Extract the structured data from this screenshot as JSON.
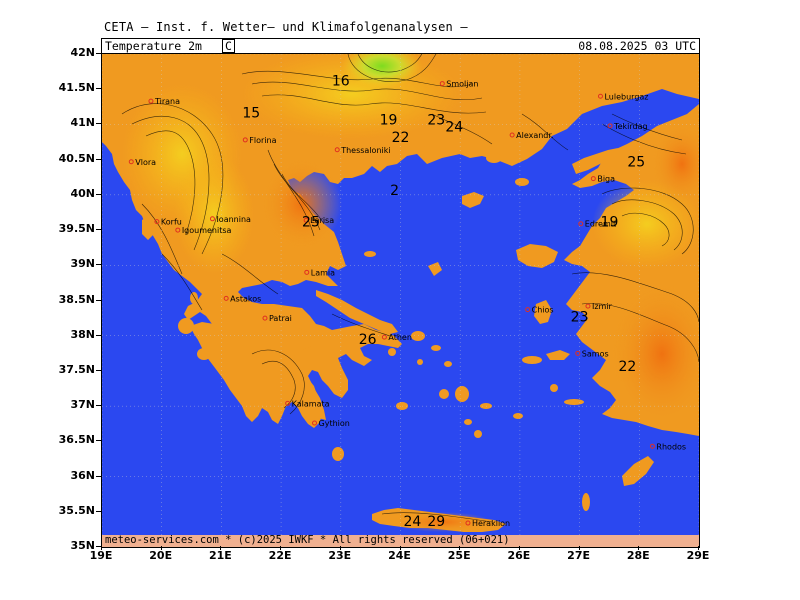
{
  "header": {
    "title": "CETA – Inst. f. Wetter– und Klimafolgenanalysen –"
  },
  "map": {
    "parameter": "Temperature 2m",
    "unit": "C",
    "valid_time": "08.08.2025 03 UTC",
    "footer": "meteo-services.com * (c)2025 IWKF * All rights reserved (06+021)",
    "lon_labels": [
      "19E",
      "20E",
      "21E",
      "22E",
      "23E",
      "24E",
      "25E",
      "26E",
      "27E",
      "28E",
      "29E"
    ],
    "lat_labels": [
      "42N",
      "41.5N",
      "41N",
      "40.5N",
      "40N",
      "39.5N",
      "39N",
      "38.5N",
      "38N",
      "37.5N",
      "37N",
      "36.5N",
      "36N",
      "35.5N",
      "35N"
    ],
    "colors": {
      "sea": "#2b48f0",
      "land_warm": "#f09a20",
      "land_hot": "#f07a10",
      "land_mild": "#f8b818",
      "land_cool": "#f4d020",
      "land_cold": "#c8e030",
      "land_coldest": "#78e020",
      "contour": "#000000",
      "city_marker": "#e03020"
    },
    "cities": [
      {
        "name": "Tirana",
        "lon": 19.82,
        "lat": 41.33
      },
      {
        "name": "Vlora",
        "lon": 19.49,
        "lat": 40.47
      },
      {
        "name": "Florina",
        "lon": 21.4,
        "lat": 40.78
      },
      {
        "name": "Thessaloniki",
        "lon": 22.94,
        "lat": 40.64
      },
      {
        "name": "Smoljan",
        "lon": 24.7,
        "lat": 41.58
      },
      {
        "name": "Alexandr.",
        "lon": 25.87,
        "lat": 40.85
      },
      {
        "name": "Luleburgaz",
        "lon": 27.35,
        "lat": 41.4
      },
      {
        "name": "Tekirdag",
        "lon": 27.51,
        "lat": 40.98
      },
      {
        "name": "Biga",
        "lon": 27.23,
        "lat": 40.23
      },
      {
        "name": "Edremit",
        "lon": 27.02,
        "lat": 39.59
      },
      {
        "name": "Korfu",
        "lon": 19.92,
        "lat": 39.62
      },
      {
        "name": "Ioannina",
        "lon": 20.85,
        "lat": 39.66
      },
      {
        "name": "Igoumenitsa",
        "lon": 20.27,
        "lat": 39.5
      },
      {
        "name": "Larisa",
        "lon": 22.42,
        "lat": 39.64
      },
      {
        "name": "Lamia",
        "lon": 22.43,
        "lat": 38.9
      },
      {
        "name": "Astakos",
        "lon": 21.08,
        "lat": 38.53
      },
      {
        "name": "Patrai",
        "lon": 21.73,
        "lat": 38.25
      },
      {
        "name": "Athen",
        "lon": 23.73,
        "lat": 37.98
      },
      {
        "name": "Izmir",
        "lon": 27.14,
        "lat": 38.42
      },
      {
        "name": "Chios",
        "lon": 26.13,
        "lat": 38.37
      },
      {
        "name": "Kalamata",
        "lon": 22.11,
        "lat": 37.04
      },
      {
        "name": "Gythion",
        "lon": 22.56,
        "lat": 36.76
      },
      {
        "name": "Samos",
        "lon": 26.97,
        "lat": 37.75
      },
      {
        "name": "Rhodos",
        "lon": 28.22,
        "lat": 36.43
      },
      {
        "name": "Heraklion",
        "lon": 25.13,
        "lat": 35.34
      }
    ],
    "temperature_labels": [
      {
        "value": "15",
        "lon": 21.5,
        "lat": 41.1
      },
      {
        "value": "16",
        "lon": 23.0,
        "lat": 41.55
      },
      {
        "value": "19",
        "lon": 23.8,
        "lat": 41.0
      },
      {
        "value": "23",
        "lon": 24.6,
        "lat": 41.0
      },
      {
        "value": "24",
        "lon": 24.9,
        "lat": 40.9
      },
      {
        "value": "22",
        "lon": 24.0,
        "lat": 40.75
      },
      {
        "value": "25",
        "lon": 22.5,
        "lat": 39.55
      },
      {
        "value": "2",
        "lon": 23.9,
        "lat": 40.0
      },
      {
        "value": "19",
        "lon": 27.5,
        "lat": 39.55
      },
      {
        "value": "23",
        "lon": 27.0,
        "lat": 38.2
      },
      {
        "value": "22",
        "lon": 27.8,
        "lat": 37.5
      },
      {
        "value": "25",
        "lon": 27.95,
        "lat": 40.4
      },
      {
        "value": "26",
        "lon": 23.45,
        "lat": 37.88
      },
      {
        "value": "24",
        "lon": 24.2,
        "lat": 35.3
      },
      {
        "value": "29",
        "lon": 24.6,
        "lat": 35.3
      }
    ]
  }
}
